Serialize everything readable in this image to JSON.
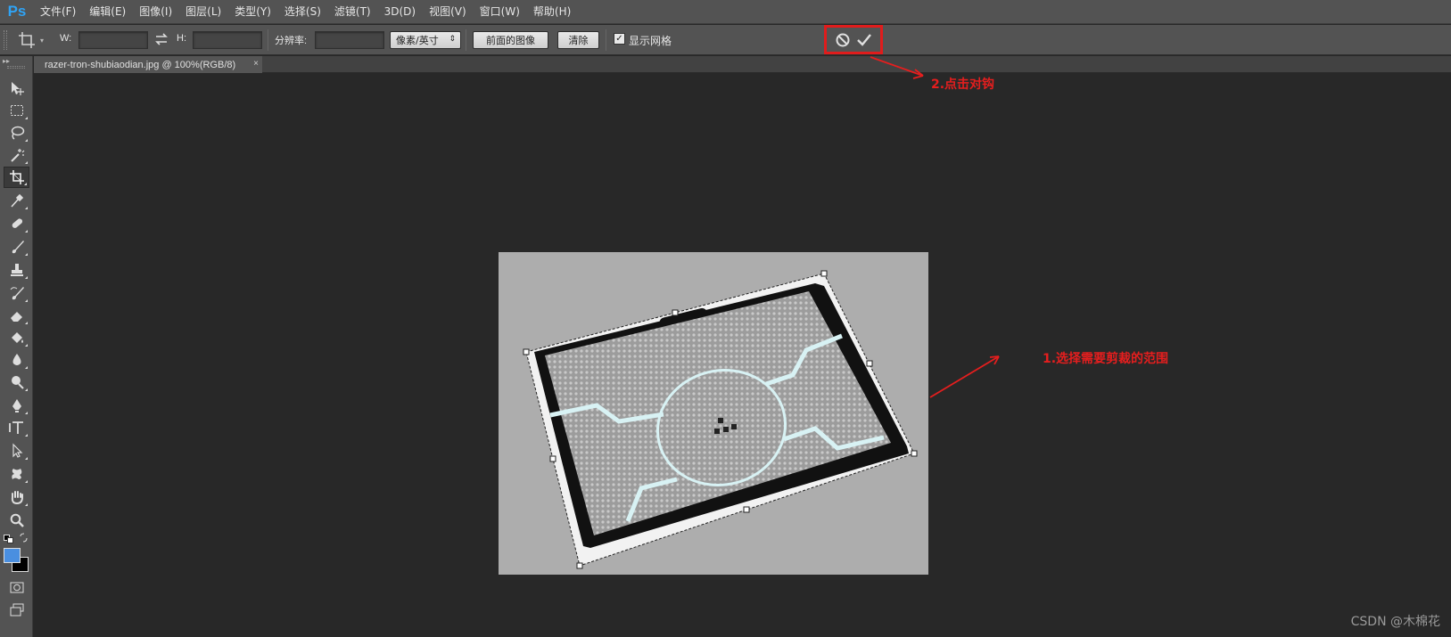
{
  "app": {
    "logo": "Ps"
  },
  "menu": [
    "文件(F)",
    "编辑(E)",
    "图像(I)",
    "图层(L)",
    "类型(Y)",
    "选择(S)",
    "滤镜(T)",
    "3D(D)",
    "视图(V)",
    "窗口(W)",
    "帮助(H)"
  ],
  "options": {
    "w_label": "W:",
    "h_label": "H:",
    "resolution_label": "分辨率:",
    "unit_select": "像素/英寸",
    "front_image_button": "前面的图像",
    "clear_button": "清除",
    "show_grid_label": "显示网格",
    "show_grid_checked": "✓"
  },
  "document": {
    "tab_title": "razer-tron-shubiaodian.jpg @ 100%(RGB/8)",
    "close": "×"
  },
  "annotations": {
    "step1": "1.选择需要剪裁的范围",
    "step2": "2.点击对钩"
  },
  "watermark": "CSDN @木棉花",
  "colors": {
    "accent_annotation": "#e51e1e",
    "foreground_swatch": "#4a8fe0",
    "background_swatch": "#000000",
    "ps_logo": "#2fa3f5"
  },
  "toolbox": [
    "move-tool",
    "marquee-tool",
    "lasso-tool",
    "magic-wand-tool",
    "crop-tool",
    "eyedropper-tool",
    "healing-brush-tool",
    "brush-tool",
    "clone-stamp-tool",
    "history-brush-tool",
    "eraser-tool",
    "paint-bucket-tool",
    "blur-tool",
    "dodge-tool",
    "pen-tool",
    "type-tool",
    "path-selection-tool",
    "shape-tool",
    "hand-tool",
    "zoom-tool"
  ]
}
